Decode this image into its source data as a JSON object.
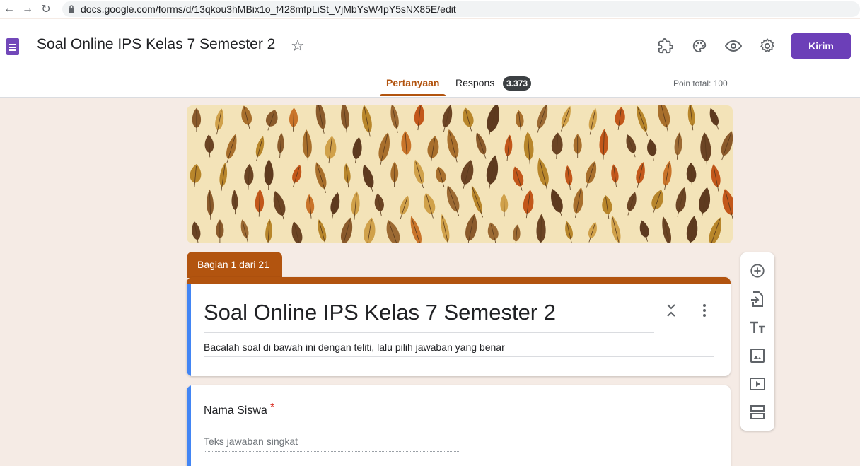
{
  "browser": {
    "url": "docs.google.com/forms/d/13qkou3hMBix1o_f428mfpLiSt_VjMbYsW4pY5sNX85E/edit"
  },
  "header": {
    "title": "Soal Online IPS Kelas 7 Semester 2",
    "send_label": "Kirim",
    "icons": [
      "addon-icon",
      "palette-icon",
      "preview-icon",
      "settings-icon"
    ]
  },
  "tabs": {
    "questions": "Pertanyaan",
    "responses": "Respons",
    "responses_count": "3.373",
    "points_total": "Poin total: 100"
  },
  "section": {
    "label": "Bagian 1 dari 21"
  },
  "form": {
    "title": "Soal Online IPS Kelas 7 Semester 2",
    "description": "Bacalah soal di bawah ini dengan teliti, lalu pilih jawaban yang benar"
  },
  "question": {
    "label": "Nama Siswa",
    "required_mark": "*",
    "answer_placeholder": "Teks jawaban singkat"
  },
  "colors": {
    "accent": "#b2540f",
    "send_button": "#6c3fb8",
    "left_border": "#4285f4",
    "background": "#f5ebe5"
  }
}
